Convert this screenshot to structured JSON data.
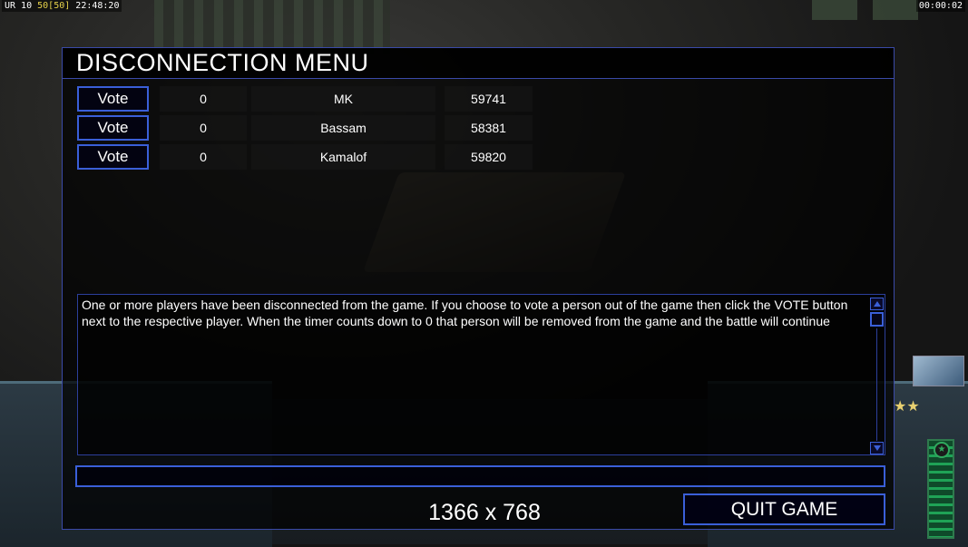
{
  "hud": {
    "top_left_prefix": "UR 10 ",
    "top_left_highlight": "50",
    "top_left_bracket": "[50]",
    "top_left_time": "22:48:20",
    "top_right_time": "00:00:02"
  },
  "dialog": {
    "title": "DISCONNECTION MENU",
    "players": [
      {
        "vote_label": "Vote",
        "count": "0",
        "name": "MK",
        "timer": "59741"
      },
      {
        "vote_label": "Vote",
        "count": "0",
        "name": "Bassam",
        "timer": "58381"
      },
      {
        "vote_label": "Vote",
        "count": "0",
        "name": "Kamalof",
        "timer": "59820"
      }
    ],
    "message": "One or more players have been disconnected from the game. If you choose to vote a person out of the game then click the VOTE button next to the respective player. When the timer counts down to 0 that person will be removed from the game and the battle will continue",
    "chat_value": "",
    "quit_label": "QUIT GAME",
    "resolution": "1366 x 768"
  },
  "colors": {
    "accent": "#3a5fd8",
    "panel_border": "#3a4aa8",
    "hud_yellow": "#e6d24a"
  }
}
